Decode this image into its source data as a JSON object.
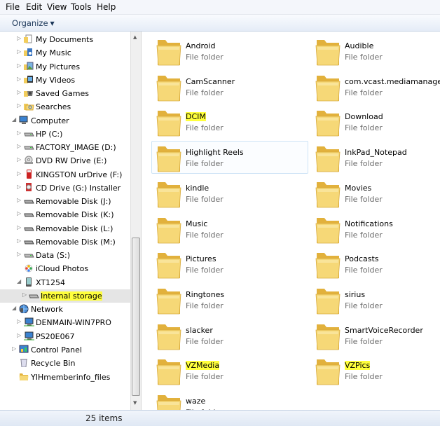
{
  "menu": [
    "File",
    "Edit",
    "View",
    "Tools",
    "Help"
  ],
  "toolbar": {
    "organize": "Organize"
  },
  "nav": [
    {
      "label": "My Documents",
      "icon": "documents-icon",
      "depth": 2,
      "arrow": "collapsed"
    },
    {
      "label": "My Music",
      "icon": "music-icon",
      "depth": 2,
      "arrow": "collapsed"
    },
    {
      "label": "My Pictures",
      "icon": "pictures-icon",
      "depth": 2,
      "arrow": "collapsed"
    },
    {
      "label": "My Videos",
      "icon": "videos-icon",
      "depth": 2,
      "arrow": "collapsed"
    },
    {
      "label": "Saved Games",
      "icon": "saved-games-icon",
      "depth": 2,
      "arrow": "collapsed"
    },
    {
      "label": "Searches",
      "icon": "searches-icon",
      "depth": 2,
      "arrow": "collapsed"
    },
    {
      "label": "Computer",
      "icon": "computer-icon",
      "depth": 1,
      "arrow": "expanded"
    },
    {
      "label": "HP (C:)",
      "icon": "hard-drive-icon",
      "depth": 2,
      "arrow": "collapsed"
    },
    {
      "label": "FACTORY_IMAGE (D:)",
      "icon": "hard-drive-icon",
      "depth": 2,
      "arrow": "collapsed"
    },
    {
      "label": "DVD RW Drive (E:)",
      "icon": "dvd-drive-icon",
      "depth": 2,
      "arrow": "collapsed"
    },
    {
      "label": "KINGSTON urDrive (F:)",
      "icon": "usb-drive-icon",
      "depth": 2,
      "arrow": "collapsed"
    },
    {
      "label": "CD Drive (G:) Installer",
      "icon": "cd-drive-icon",
      "depth": 2,
      "arrow": "collapsed"
    },
    {
      "label": "Removable Disk (J:)",
      "icon": "removable-disk-icon",
      "depth": 2,
      "arrow": "collapsed"
    },
    {
      "label": "Removable Disk (K:)",
      "icon": "removable-disk-icon",
      "depth": 2,
      "arrow": "collapsed"
    },
    {
      "label": "Removable Disk (L:)",
      "icon": "removable-disk-icon",
      "depth": 2,
      "arrow": "collapsed"
    },
    {
      "label": "Removable Disk (M:)",
      "icon": "removable-disk-icon",
      "depth": 2,
      "arrow": "collapsed"
    },
    {
      "label": "Data (S:)",
      "icon": "hard-drive-icon",
      "depth": 2,
      "arrow": "collapsed"
    },
    {
      "label": "iCloud Photos",
      "icon": "icloud-photos-icon",
      "depth": 2,
      "arrow": "none"
    },
    {
      "label": "XT1254",
      "icon": "phone-icon",
      "depth": 2,
      "arrow": "expanded"
    },
    {
      "label": "Internal storage",
      "icon": "storage-icon",
      "depth": 3,
      "arrow": "collapsed",
      "selected": true,
      "highlight": true
    },
    {
      "label": "Network",
      "icon": "network-icon",
      "depth": 1,
      "arrow": "expanded"
    },
    {
      "label": "DENMAIN-WIN7PRO",
      "icon": "network-computer-icon",
      "depth": 2,
      "arrow": "collapsed"
    },
    {
      "label": "PS20E067",
      "icon": "network-computer-icon",
      "depth": 2,
      "arrow": "collapsed"
    },
    {
      "label": "Control Panel",
      "icon": "control-panel-icon",
      "depth": 1,
      "arrow": "collapsed"
    },
    {
      "label": "Recycle Bin",
      "icon": "recycle-bin-icon",
      "depth": 1,
      "arrow": "none"
    },
    {
      "label": "YIHmemberinfo_files",
      "icon": "folder-icon",
      "depth": 1,
      "arrow": "none"
    }
  ],
  "folder_type": "File folder",
  "folders": [
    {
      "name": "Android"
    },
    {
      "name": "Audible"
    },
    {
      "name": "CamScanner"
    },
    {
      "name": "com.vcast.mediamanager"
    },
    {
      "name": "DCIM",
      "highlight": true
    },
    {
      "name": "Download"
    },
    {
      "name": "Highlight Reels",
      "selected": true
    },
    {
      "name": "InkPad_Notepad"
    },
    {
      "name": "kindle"
    },
    {
      "name": "Movies"
    },
    {
      "name": "Music"
    },
    {
      "name": "Notifications"
    },
    {
      "name": "Pictures"
    },
    {
      "name": "Podcasts"
    },
    {
      "name": "Ringtones"
    },
    {
      "name": "sirius"
    },
    {
      "name": "slacker"
    },
    {
      "name": "SmartVoiceRecorder"
    },
    {
      "name": "VZMedia",
      "highlight": true
    },
    {
      "name": "VZPics",
      "highlight": true
    },
    {
      "name": "waze"
    }
  ],
  "status": {
    "items": "25 items"
  },
  "colors": {
    "highlight": "#ffff3c",
    "folder": "#f2cd5c",
    "selection_border": "#cde3f6"
  }
}
